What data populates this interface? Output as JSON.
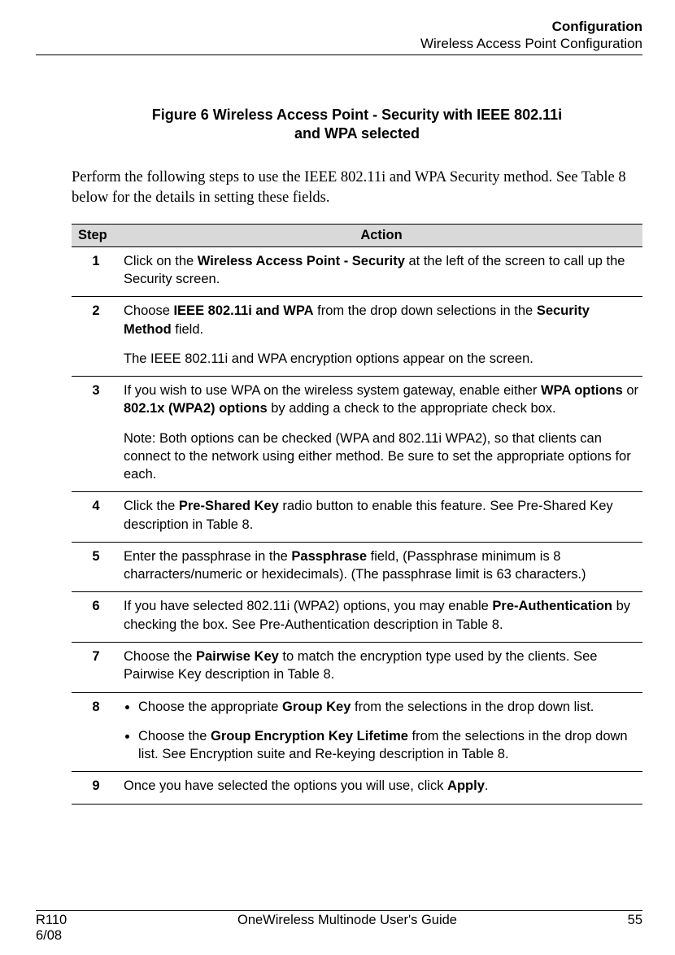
{
  "header": {
    "line1": "Configuration",
    "line2": "Wireless Access Point Configuration"
  },
  "figure": {
    "line1": "Figure 6  Wireless Access Point - Security with IEEE 802.11i",
    "line2": "and WPA selected"
  },
  "intro": "Perform the following steps to use the IEEE 802.11i and WPA Security method.  See Table 8 below for the details in setting these fields.",
  "table": {
    "head_step": "Step",
    "head_action": "Action",
    "rows": {
      "r1": {
        "num": "1",
        "pre": "Click on the ",
        "b1": "Wireless Access Point - Security",
        "post": " at the left of the screen to call up the Security screen."
      },
      "r2": {
        "num": "2",
        "p1_pre": "Choose ",
        "p1_b1": "IEEE 802.11i and WPA",
        "p1_mid": " from the drop down selections in the ",
        "p1_b2": "Security Method",
        "p1_post": " field.",
        "p2": "The IEEE 802.11i and WPA encryption options appear on the screen."
      },
      "r3": {
        "num": "3",
        "p1_pre": "If you wish to use WPA on the wireless system gateway, enable either ",
        "p1_b1": "WPA options",
        "p1_mid": " or ",
        "p1_b2": "802.1x (WPA2) options",
        "p1_post": " by adding a check to the appropriate check box.",
        "p2": "Note: Both options can be checked (WPA and 802.11i WPA2), so that clients can connect to the network using either method.  Be sure to set the appropriate options for each."
      },
      "r4": {
        "num": "4",
        "pre": "Click the ",
        "b1": "Pre-Shared Key",
        "post": " radio button to enable this feature. See Pre-Shared Key description in Table 8."
      },
      "r5": {
        "num": "5",
        "pre": "Enter the passphrase in the ",
        "b1": "Passphrase",
        "post": " field, (Passphrase minimum is 8 charracters/numeric or hexidecimals).  (The passphrase limit is 63 characters.)"
      },
      "r6": {
        "num": "6",
        "pre": "If you have selected 802.11i (WPA2) options, you may enable ",
        "b1": "Pre-Authentication",
        "post": " by checking the box.  See Pre-Authentication description in Table 8."
      },
      "r7": {
        "num": "7",
        "pre": "Choose the ",
        "b1": "Pairwise Key",
        "post": " to match the encryption type used by the clients.  See Pairwise Key description in Table 8."
      },
      "r8": {
        "num": "8",
        "li1_pre": "Choose the appropriate ",
        "li1_b1": "Group Key",
        "li1_post": " from the selections in the drop down list.",
        "li2_pre": "Choose the ",
        "li2_b1": "Group Encryption Key Lifetime",
        "li2_post": " from the selections in the drop down list.  See Encryption suite and Re-keying description in Table 8."
      },
      "r9": {
        "num": "9",
        "pre": "Once you have selected the options you will use, click ",
        "b1": "Apply",
        "post": "."
      }
    }
  },
  "footer": {
    "left1": "R110",
    "left2": "6/08",
    "center": "OneWireless Multinode User's Guide",
    "right": "55"
  }
}
